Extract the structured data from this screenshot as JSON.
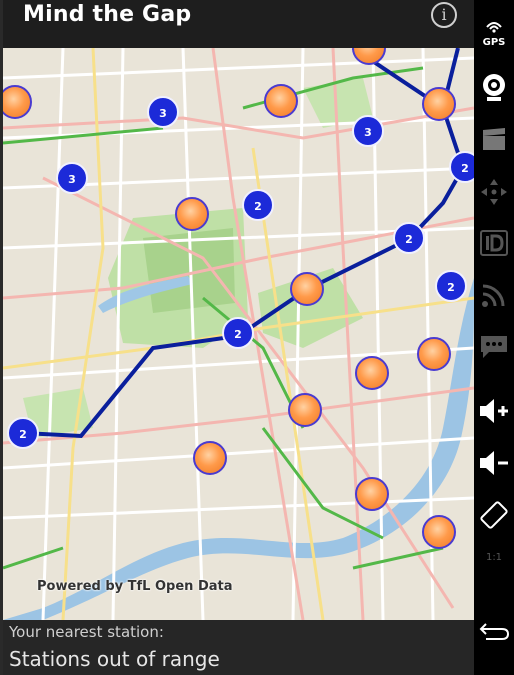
{
  "app": {
    "title": "Mind the Gap",
    "info_icon": "info-icon"
  },
  "map": {
    "attribution": "Powered by TfL Open Data",
    "clusters": [
      {
        "count": "3"
      },
      {
        "count": "3"
      },
      {
        "count": "3"
      },
      {
        "count": "2"
      },
      {
        "count": "2"
      },
      {
        "count": "2"
      },
      {
        "count": "2"
      },
      {
        "count": "2"
      },
      {
        "count": "2"
      }
    ],
    "colors": {
      "line": "#0a1f9c",
      "cluster": "#1c2ad8",
      "station": "#ff9a4a"
    }
  },
  "bottom": {
    "nearest_label": "Your nearest station:",
    "nearest_value": "Stations out of range"
  },
  "rail": {
    "gps_label": "GPS",
    "icons": [
      "gps-icon",
      "camera-icon",
      "clapperboard-icon",
      "dpad-icon",
      "id-icon",
      "rss-icon",
      "chat-icon",
      "volume-up-icon",
      "volume-down-icon",
      "rotate-icon",
      "scale-icon",
      "back-icon"
    ],
    "scale_label": "1:1"
  }
}
